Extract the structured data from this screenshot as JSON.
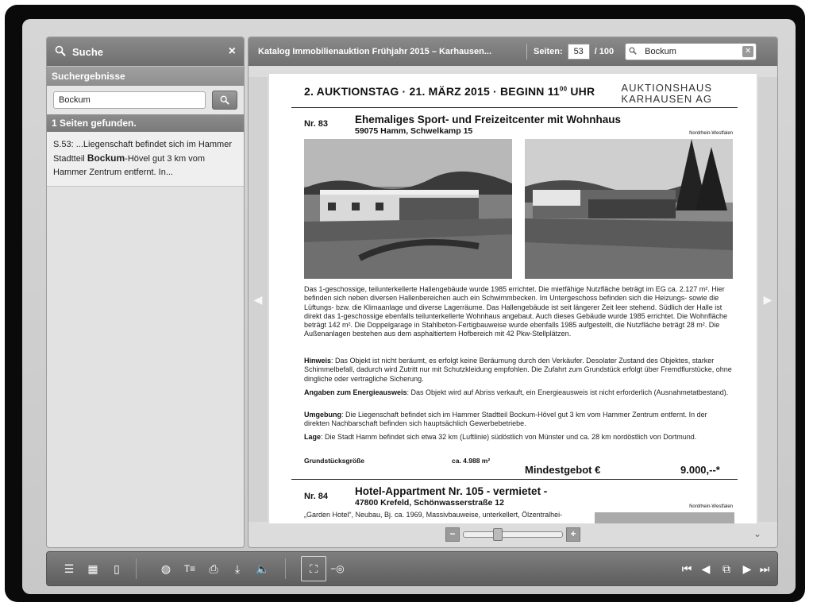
{
  "sidebar": {
    "title": "Suche",
    "close_icon": "×",
    "results_label": "Suchergebnisse",
    "search_value": "Bockum",
    "found_label": "1 Seiten gefunden.",
    "result": {
      "prefix": "S.53: ...Liegenschaft befindet sich im Hammer Stadtteil ",
      "highlight": "Bockum",
      "suffix": "-Hövel gut 3 km vom Hammer Zentrum entfernt. In..."
    }
  },
  "header": {
    "title": "Katalog Immobilienauktion Frühjahr 2015 – Karhausen...",
    "pages_label": "Seiten:",
    "current_page": "53",
    "total_pages": "/ 100",
    "search_value": "Bockum"
  },
  "page": {
    "header_text": "2. AUKTIONSTAG  ·  21. MÄRZ 2015  ·  BEGINN 11",
    "header_sup": "00",
    "header_suffix": " UHR",
    "logo_line1": "AUKTIONSHAUS",
    "logo_line2": "KARHAUSEN AG",
    "lot1": {
      "number": "Nr. 83",
      "title": "Ehemaliges Sport- und Freizeitcenter mit Wohnhaus",
      "address": "59075 Hamm, Schwelkamp 15",
      "region": "Nordrhein-Westfalen",
      "description": "Das 1-geschossige, teilunterkellerte Hallengebäude wurde 1985 errichtet. Die mietfähige Nutzfläche beträgt im EG ca. 2.127 m². Hier befinden sich neben diversen Hallenbereichen auch ein Schwimmbecken. Im Untergeschoss befinden sich die Heizungs- sowie die Lüftungs- bzw. die Klimaanlage und diverse Lagerräume. Das Hallengebäude ist seit längerer Zeit leer stehend. Südlich der Halle ist direkt das 1-geschossige ebenfalls teilunterkellerte Wohnhaus angebaut. Auch dieses Gebäude wurde 1985 errichtet. Die Wohnfläche beträgt 142 m². Die Doppelgarage in Stahlbeton-Fertigbauweise wurde ebenfalls 1985 aufgestellt, die Nutzfläche beträgt 28 m². Die Außenanlagen bestehen aus dem asphaltiertem Hofbereich mit 42 Pkw-Stellplätzen.",
      "hinweis_label": "Hinweis",
      "hinweis": ": Das Objekt ist nicht beräumt, es erfolgt keine Beräumung durch den Verkäufer. Desolater Zustand des Objektes, starker Schimmelbefall, dadurch wird Zutritt nur mit Schutzkleidung empfohlen. Die Zufahrt zum Grundstück erfolgt über Fremdflurstücke, ohne dingliche oder vertragliche Sicherung.",
      "energie_label": "Angaben zum Energieausweis",
      "energie": ": Das Objekt wird auf Abriss verkauft, ein Energieausweis ist nicht erforderlich (Ausnahmetatbestand).",
      "umgebung_label": "Umgebung",
      "umgebung": ": Die Liegenschaft befindet sich im Hammer Stadtteil Bockum-Hövel gut 3 km vom Hammer Zentrum entfernt. In der direkten Nachbarschaft befinden sich hauptsächlich Gewerbebetriebe.",
      "lage_label": "Lage",
      "lage": ": Die Stadt Hamm befindet sich etwa 32 km (Luftlinie) südöstlich von Münster und ca. 28 km nordöstlich von Dortmund.",
      "grund_label": "Grundstücksgröße",
      "grund_value": "ca. 4.988 m²",
      "min_label": "Mindestgebot €",
      "min_value": "9.000,--*"
    },
    "lot2": {
      "number": "Nr. 84",
      "title": "Hotel-Appartment Nr. 105 - vermietet -",
      "address": "47800 Krefeld, Schönwasserstraße 12",
      "region": "Nordrhein-Westfalen",
      "description": "„Garden Hotel“, Neubau, Bj. ca. 1969, Massivbauweise, unterkellert, Ölzentralhei-"
    }
  },
  "zoom": {
    "minus": "−",
    "plus": "+",
    "level": 0.3
  },
  "colors": {
    "background": "#0a0a0a",
    "panel": "#e2e2e2",
    "header": "#7a7a7a"
  }
}
